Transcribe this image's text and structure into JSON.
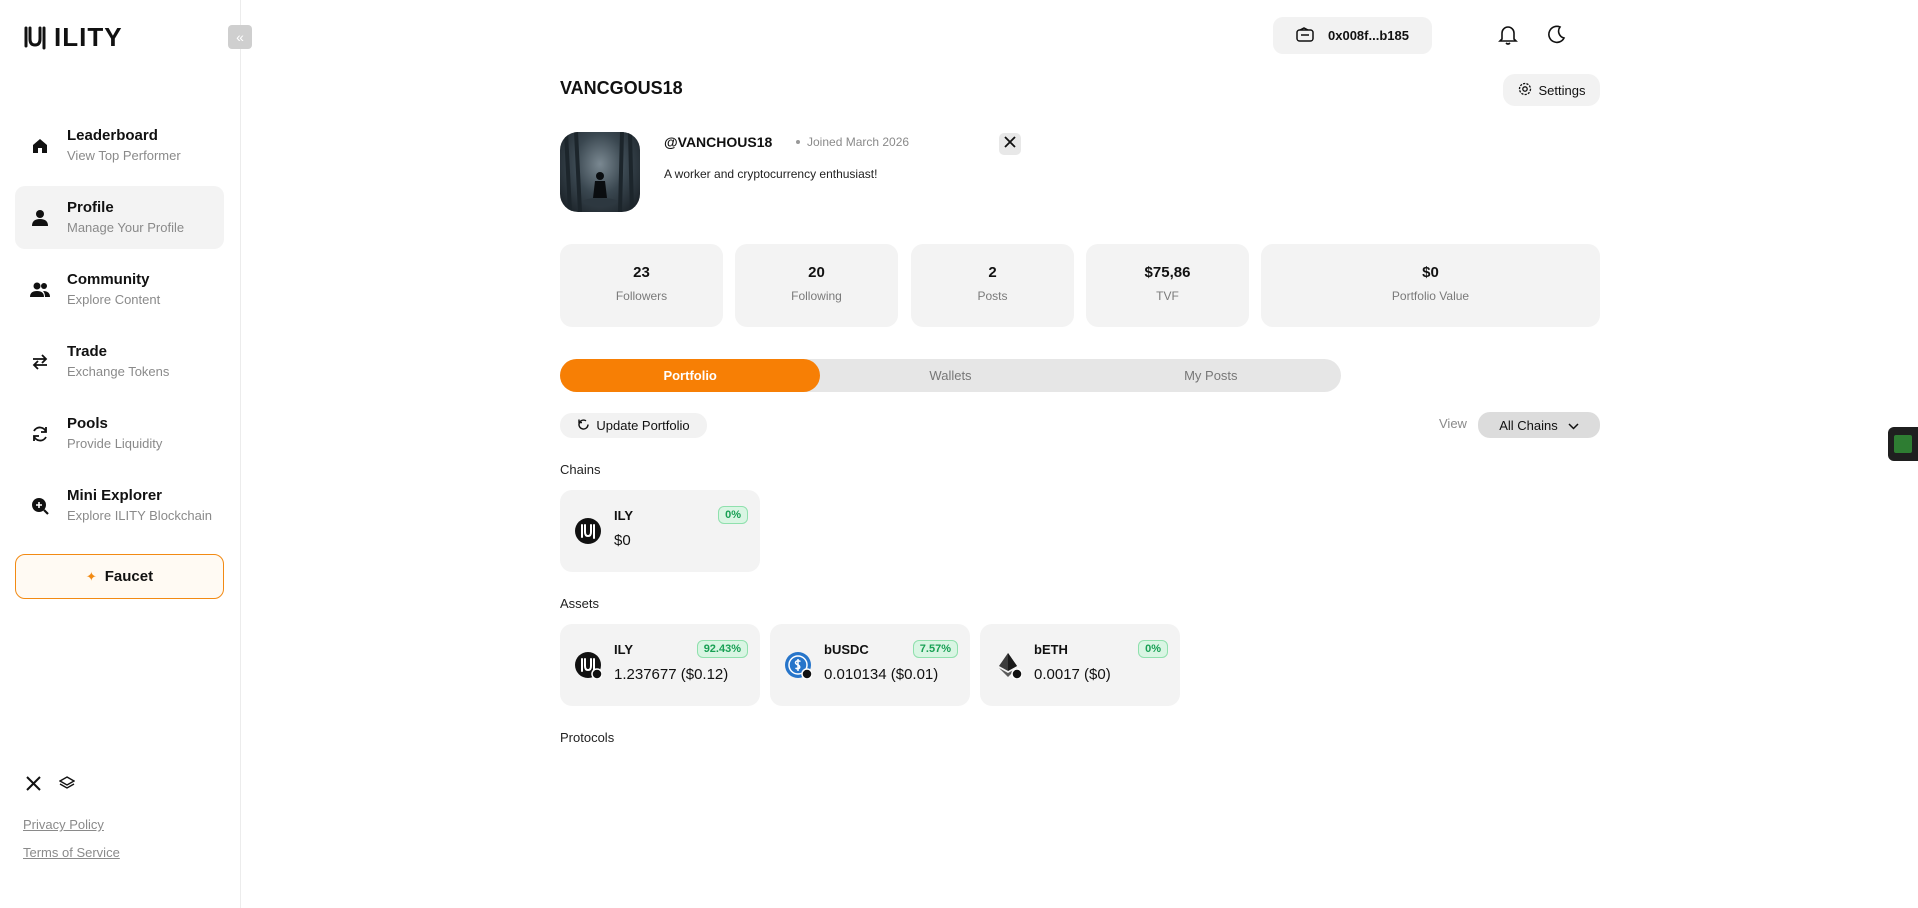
{
  "brand": {
    "name": "ILITY"
  },
  "sidebar": {
    "items": [
      {
        "title": "Leaderboard",
        "subtitle": "View Top Performer",
        "icon": "home-icon"
      },
      {
        "title": "Profile",
        "subtitle": "Manage Your Profile",
        "icon": "user-icon"
      },
      {
        "title": "Community",
        "subtitle": "Explore Content",
        "icon": "users-icon"
      },
      {
        "title": "Trade",
        "subtitle": "Exchange Tokens",
        "icon": "swap-icon"
      },
      {
        "title": "Pools",
        "subtitle": "Provide Liquidity",
        "icon": "refresh-icon"
      },
      {
        "title": "Mini Explorer",
        "subtitle": "Explore ILITY Blockchain",
        "icon": "search-plus-icon"
      }
    ],
    "faucet_label": "Faucet",
    "privacy": "Privacy Policy",
    "terms": "Terms of Service"
  },
  "header": {
    "wallet": "0x008f...b185"
  },
  "profile": {
    "title": "VANCGOUS18",
    "settings_label": "Settings",
    "handle": "@VANCHOUS18",
    "joined": "Joined March 2026",
    "bio": "A worker and cryptocurrency enthusiast!"
  },
  "stats": [
    {
      "value": "23",
      "label": "Followers"
    },
    {
      "value": "20",
      "label": "Following"
    },
    {
      "value": "2",
      "label": "Posts"
    },
    {
      "value": "$75,86",
      "label": "TVF"
    },
    {
      "value": "$0",
      "label": "Portfolio Value"
    }
  ],
  "tabs": [
    {
      "label": "Portfolio"
    },
    {
      "label": "Wallets"
    },
    {
      "label": "My Posts"
    }
  ],
  "toolbar": {
    "update_label": "Update Portfolio",
    "view_label": "View",
    "chain_select": "All Chains"
  },
  "sections": {
    "chains": "Chains",
    "assets": "Assets",
    "protocols": "Protocols"
  },
  "chains": [
    {
      "name": "ILY",
      "value": "$0",
      "badge": "0%"
    }
  ],
  "assets": [
    {
      "name": "ILY",
      "value": "1.237677 ($0.12)",
      "badge": "92.43%"
    },
    {
      "name": "bUSDC",
      "value": "0.010134 ($0.01)",
      "badge": "7.57%"
    },
    {
      "name": "bETH",
      "value": "0.0017 ($0)",
      "badge": "0%"
    }
  ],
  "colors": {
    "accent": "#f77f05",
    "badge_green": "#18a054"
  }
}
